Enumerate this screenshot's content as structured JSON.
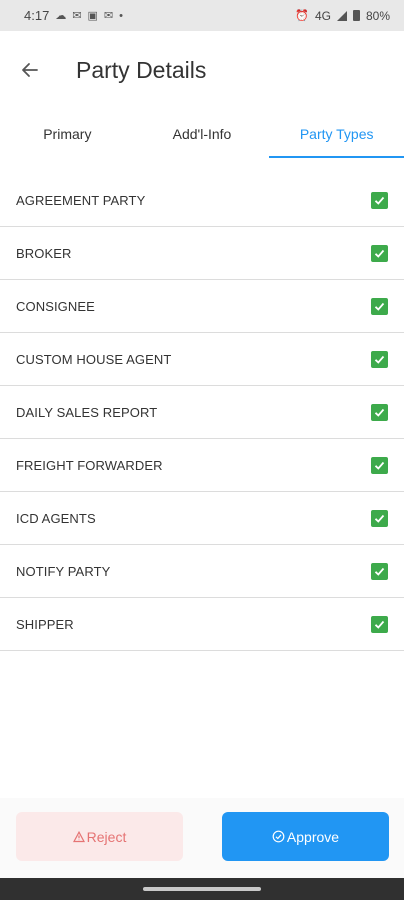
{
  "status_bar": {
    "time": "4:17",
    "battery": "80%",
    "network": "4G"
  },
  "header": {
    "title": "Party Details",
    "back_icon": "arrow-left-icon"
  },
  "tabs": [
    {
      "label": "Primary",
      "active": false
    },
    {
      "label": "Add'l-Info",
      "active": false
    },
    {
      "label": "Party Types",
      "active": true
    }
  ],
  "party_types": [
    {
      "label": "AGREEMENT PARTY",
      "checked": true
    },
    {
      "label": "BROKER",
      "checked": true
    },
    {
      "label": "CONSIGNEE",
      "checked": true
    },
    {
      "label": "CUSTOM HOUSE AGENT",
      "checked": true
    },
    {
      "label": "DAILY SALES REPORT",
      "checked": true
    },
    {
      "label": "FREIGHT FORWARDER",
      "checked": true
    },
    {
      "label": "ICD AGENTS",
      "checked": true
    },
    {
      "label": "NOTIFY PARTY",
      "checked": true
    },
    {
      "label": "SHIPPER",
      "checked": true
    }
  ],
  "actions": {
    "reject_label": "Reject",
    "approve_label": "Approve"
  },
  "colors": {
    "accent": "#2196f3",
    "check": "#3daa4b",
    "reject_bg": "#fbe9e9",
    "reject_text": "#e57373"
  }
}
